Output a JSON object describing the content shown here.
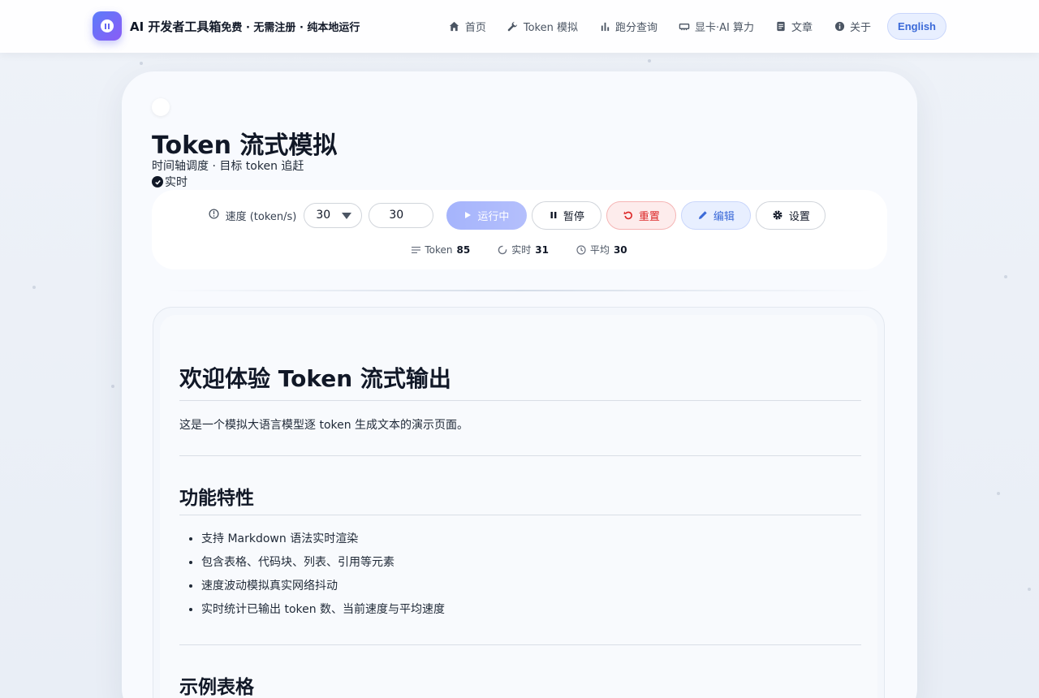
{
  "header": {
    "brand_title": "AI 开发者工具箱",
    "brand_sub": "免费 · 无需注册 · 纯本地运行",
    "nav": [
      {
        "label": "首页",
        "icon": "home-icon"
      },
      {
        "label": "Token 模拟",
        "icon": "wrench-icon"
      },
      {
        "label": "跑分查询",
        "icon": "bar-chart-icon"
      },
      {
        "label": "显卡·AI 算力",
        "icon": "gpu-icon"
      },
      {
        "label": "文章",
        "icon": "document-icon"
      },
      {
        "label": "关于",
        "icon": "info-icon"
      }
    ],
    "lang_button": "English"
  },
  "page": {
    "title": "Token 流式模拟",
    "subtitle": "时间轴调度 · 目标 token 追赶",
    "live_tag": "实时"
  },
  "controls": {
    "speed_label": "速度 (token/s)",
    "speed_select": "30",
    "speed_input": "30",
    "run_label": "运行中",
    "pause_label": "暂停",
    "reset_label": "重置",
    "edit_label": "编辑",
    "settings_label": "设置"
  },
  "stats": {
    "token_label": "Token",
    "token_value": "85",
    "live_label": "实时",
    "live_value": "31",
    "avg_label": "平均",
    "avg_value": "30"
  },
  "content": {
    "h1": "欢迎体验 Token 流式输出",
    "intro": "这是一个模拟大语言模型逐 token 生成文本的演示页面。",
    "h2_features": "功能特性",
    "features": [
      "支持 Markdown 语法实时渲染",
      "包含表格、代码块、列表、引用等元素",
      "速度波动模拟真实网络抖动",
      "实时统计已输出 token 数、当前速度与平均速度"
    ],
    "h2_table": "示例表格"
  },
  "colors": {
    "accent": "#3b6ad8",
    "run_button": "#a5b4fc",
    "reset": "#dc2626",
    "brand_gradient_start": "#5b7cfa",
    "brand_gradient_end": "#8b5cf6"
  }
}
